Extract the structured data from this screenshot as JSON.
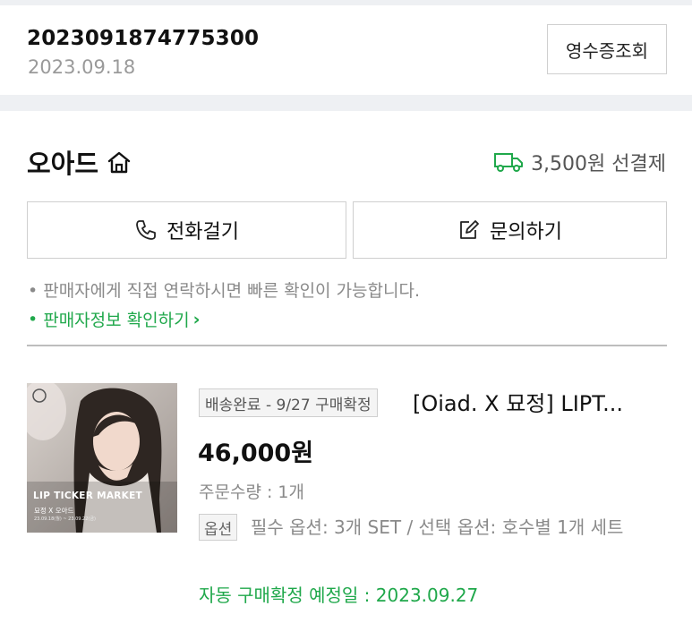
{
  "order": {
    "number": "2023091874775300",
    "date": "2023.09.18",
    "receipt_button": "영수증조회"
  },
  "store": {
    "name": "오아드",
    "home_icon": "home-icon",
    "shipping_text": "3,500원 선결제",
    "truck_icon": "truck-icon",
    "truck_color": "#20a84b"
  },
  "actions": {
    "call_label": "전화걸기",
    "inquiry_label": "문의하기"
  },
  "notice": {
    "bullet": "•",
    "text": "판매자에게 직접 연락하시면 빠른 확인이 가능합니다.",
    "seller_link": "판매자정보 확인하기",
    "chevron": "›"
  },
  "product": {
    "image": {
      "title": "LIP TICKER MARKET",
      "subtitle": "묘정 X 오아드",
      "date_line": "23.09.18(월) ~ 23.09.22(금)"
    },
    "status_badge": "배송완료 - 9/27 구매확정",
    "title": "[Oiad. X 묘정] LIPT...",
    "price": "46,000원",
    "quantity": "주문수량 : 1개",
    "option_badge": "옵션",
    "option_text": "필수 옵션: 3개 SET / 선택 옵션: 호수별 1개 세트",
    "auto_confirm": "자동 구매확정 예정일 : 2023.09.27"
  },
  "colors": {
    "accent_green": "#20a84b",
    "muted": "#8a8a8a",
    "border": "#cfcfcf"
  }
}
